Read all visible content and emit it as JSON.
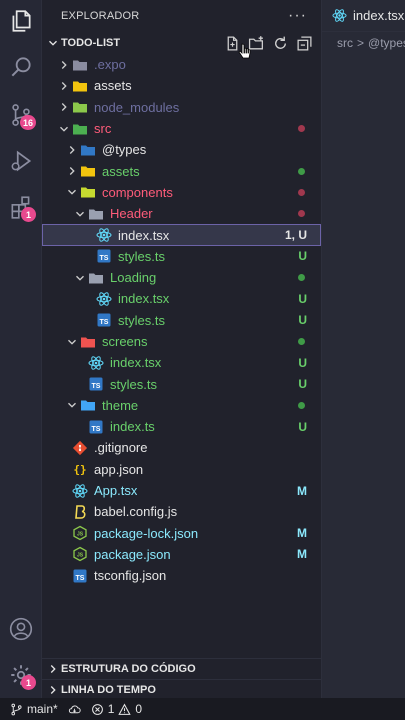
{
  "activity_bar": {
    "source_control_badge": "16",
    "extensions_badge": "1",
    "manage_badge": "1"
  },
  "explorer": {
    "title": "EXPLORADOR",
    "more": "···",
    "workspace": "TODO-LIST",
    "items": [
      {
        "name": ".expo",
        "type": "folder",
        "depth": 0,
        "expanded": false,
        "color": "#6e6fa0",
        "icon": "folder-expo-icon"
      },
      {
        "name": "assets",
        "type": "folder",
        "depth": 0,
        "expanded": false,
        "color": "#e6e6e6",
        "icon": "folder-assets-icon"
      },
      {
        "name": "node_modules",
        "type": "folder",
        "depth": 0,
        "expanded": false,
        "color": "#6e6fa0",
        "icon": "folder-node-icon"
      },
      {
        "name": "src",
        "type": "folder",
        "depth": 0,
        "expanded": true,
        "color": "#ff5c7a",
        "icon": "folder-src-icon",
        "dot": "#a0384e"
      },
      {
        "name": "@types",
        "type": "folder",
        "depth": 1,
        "expanded": false,
        "color": "#e6e6e6",
        "icon": "folder-types-icon"
      },
      {
        "name": "assets",
        "type": "folder",
        "depth": 1,
        "expanded": false,
        "color": "#69d06b",
        "icon": "folder-assets-icon",
        "dot": "#3f9b47"
      },
      {
        "name": "components",
        "type": "folder",
        "depth": 1,
        "expanded": true,
        "color": "#ff5c7a",
        "icon": "folder-components-icon",
        "dot": "#a0384e"
      },
      {
        "name": "Header",
        "type": "folder",
        "depth": 2,
        "expanded": true,
        "color": "#ff5c7a",
        "icon": "folder-icon",
        "dot": "#a0384e"
      },
      {
        "name": "index.tsx",
        "type": "react",
        "depth": 3,
        "color": "#e6e6e6",
        "icon": "react-icon",
        "deco": "1, U",
        "deco_color": "#e6e6e6",
        "selected": true
      },
      {
        "name": "styles.ts",
        "type": "ts",
        "depth": 3,
        "color": "#69d06b",
        "icon": "typescript-icon",
        "deco": "U",
        "deco_color": "#69d06b"
      },
      {
        "name": "Loading",
        "type": "folder",
        "depth": 2,
        "expanded": true,
        "color": "#69d06b",
        "icon": "folder-icon",
        "dot": "#3f9b47"
      },
      {
        "name": "index.tsx",
        "type": "react",
        "depth": 3,
        "color": "#69d06b",
        "icon": "react-icon",
        "deco": "U",
        "deco_color": "#69d06b"
      },
      {
        "name": "styles.ts",
        "type": "ts",
        "depth": 3,
        "color": "#69d06b",
        "icon": "typescript-icon",
        "deco": "U",
        "deco_color": "#69d06b"
      },
      {
        "name": "screens",
        "type": "folder",
        "depth": 1,
        "expanded": true,
        "color": "#69d06b",
        "icon": "folder-screens-icon",
        "dot": "#3f9b47"
      },
      {
        "name": "index.tsx",
        "type": "react",
        "depth": 2,
        "color": "#69d06b",
        "icon": "react-icon",
        "deco": "U",
        "deco_color": "#69d06b"
      },
      {
        "name": "styles.ts",
        "type": "ts",
        "depth": 2,
        "color": "#69d06b",
        "icon": "typescript-icon",
        "deco": "U",
        "deco_color": "#69d06b"
      },
      {
        "name": "theme",
        "type": "folder",
        "depth": 1,
        "expanded": true,
        "color": "#69d06b",
        "icon": "folder-theme-icon",
        "dot": "#3f9b47"
      },
      {
        "name": "index.ts",
        "type": "ts",
        "depth": 2,
        "color": "#69d06b",
        "icon": "typescript-icon",
        "deco": "U",
        "deco_color": "#69d06b"
      },
      {
        "name": ".gitignore",
        "type": "git",
        "depth": 0,
        "color": "#e6e6e6",
        "icon": "git-icon"
      },
      {
        "name": "app.json",
        "type": "json",
        "depth": 0,
        "color": "#e6e6e6",
        "icon": "json-icon"
      },
      {
        "name": "App.tsx",
        "type": "react",
        "depth": 0,
        "color": "#8be9fd",
        "icon": "react-icon",
        "deco": "M",
        "deco_color": "#8be9fd"
      },
      {
        "name": "babel.config.js",
        "type": "babel",
        "depth": 0,
        "color": "#e6e6e6",
        "icon": "babel-icon"
      },
      {
        "name": "package-lock.json",
        "type": "node",
        "depth": 0,
        "color": "#8be9fd",
        "icon": "nodejs-icon",
        "deco": "M",
        "deco_color": "#8be9fd"
      },
      {
        "name": "package.json",
        "type": "node",
        "depth": 0,
        "color": "#8be9fd",
        "icon": "nodejs-icon",
        "deco": "M",
        "deco_color": "#8be9fd"
      },
      {
        "name": "tsconfig.json",
        "type": "tsconfig",
        "depth": 0,
        "color": "#e6e6e6",
        "icon": "tsconfig-icon"
      }
    ],
    "outline_section": "ESTRUTURA DO CÓDIGO",
    "timeline_section": "LINHA DO TEMPO"
  },
  "editor": {
    "tab_label": "index.tsx",
    "breadcrumb": [
      "src",
      "@types"
    ],
    "breadcrumb_sep": ">"
  },
  "status_bar": {
    "branch": "main*",
    "errors": "1",
    "warnings": "0"
  },
  "colors": {
    "accent": "#bd93f9",
    "modified": "#8be9fd",
    "untracked": "#69d06b",
    "error": "#ff5c7a",
    "badge": "#e8498e"
  }
}
